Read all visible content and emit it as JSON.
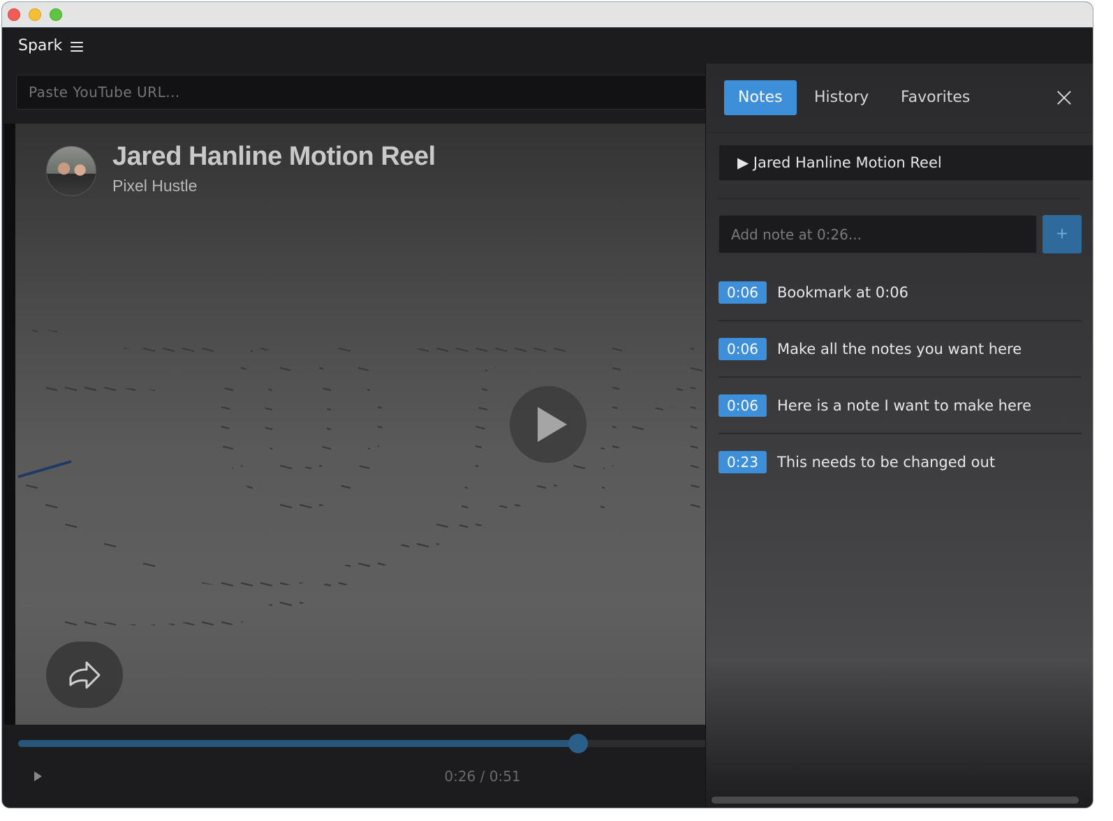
{
  "app": {
    "name": "Spark"
  },
  "url_bar": {
    "placeholder": "Paste YouTube URL..."
  },
  "video": {
    "title": "Jared Hanline Motion Reel",
    "channel": "Pixel Hustle",
    "current_time": "0:26 / 0:51",
    "progress_fraction": 0.51
  },
  "panel": {
    "tabs": [
      {
        "label": "Notes",
        "active": true
      },
      {
        "label": "History",
        "active": false
      },
      {
        "label": "Favorites",
        "active": false
      }
    ],
    "selected_video": "▶ Jared Hanline Motion Reel",
    "note_input_placeholder": "Add note at 0:26...",
    "add_label": "+",
    "notes": [
      {
        "time": "0:06",
        "text": "Bookmark at 0:06"
      },
      {
        "time": "0:06",
        "text": "Make all the notes you want here"
      },
      {
        "time": "0:06",
        "text": "Here is a note I want to make here"
      },
      {
        "time": "0:23",
        "text": "This needs to be changed out"
      }
    ]
  },
  "colors": {
    "accent": "#3d8fd9",
    "progress": "#28567a",
    "background": "#1c1c1e"
  }
}
